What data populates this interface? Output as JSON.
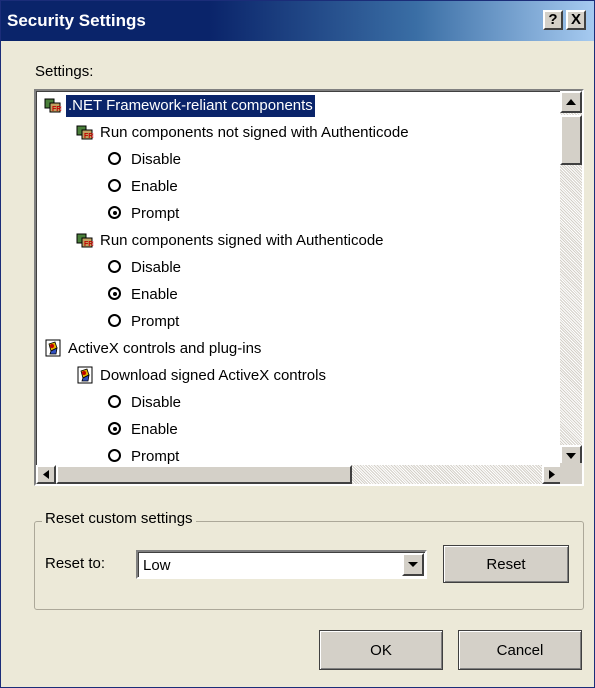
{
  "window": {
    "title": "Security Settings",
    "help_glyph": "?",
    "close_glyph": "X"
  },
  "settings_label": "Settings:",
  "tree": [
    {
      "text": ".NET Framework-reliant components",
      "kind": "category",
      "icon": "net-components-icon",
      "selected": true
    },
    {
      "text": "Run components not signed with Authenticode",
      "kind": "setting",
      "icon": "net-components-icon"
    },
    {
      "text": "Disable",
      "kind": "option",
      "checked": false
    },
    {
      "text": "Enable",
      "kind": "option",
      "checked": false
    },
    {
      "text": "Prompt",
      "kind": "option",
      "checked": true
    },
    {
      "text": "Run components signed with Authenticode",
      "kind": "setting",
      "icon": "net-components-icon"
    },
    {
      "text": "Disable",
      "kind": "option",
      "checked": false
    },
    {
      "text": "Enable",
      "kind": "option",
      "checked": true
    },
    {
      "text": "Prompt",
      "kind": "option",
      "checked": false
    },
    {
      "text": "ActiveX controls and plug-ins",
      "kind": "category",
      "icon": "activex-icon"
    },
    {
      "text": "Download signed ActiveX controls",
      "kind": "setting",
      "icon": "activex-icon"
    },
    {
      "text": "Disable",
      "kind": "option",
      "checked": false
    },
    {
      "text": "Enable",
      "kind": "option",
      "checked": true
    },
    {
      "text": "Prompt",
      "kind": "option",
      "checked": false
    }
  ],
  "reset_group": {
    "title": "Reset custom settings",
    "reset_to_label": "Reset to:",
    "selected_level": "Low",
    "reset_button": "Reset"
  },
  "buttons": {
    "ok": "OK",
    "cancel": "Cancel"
  },
  "colors": {
    "selection": "#0a246a",
    "dialog_bg": "#ece9d8",
    "title_bar": "#0a246a"
  }
}
